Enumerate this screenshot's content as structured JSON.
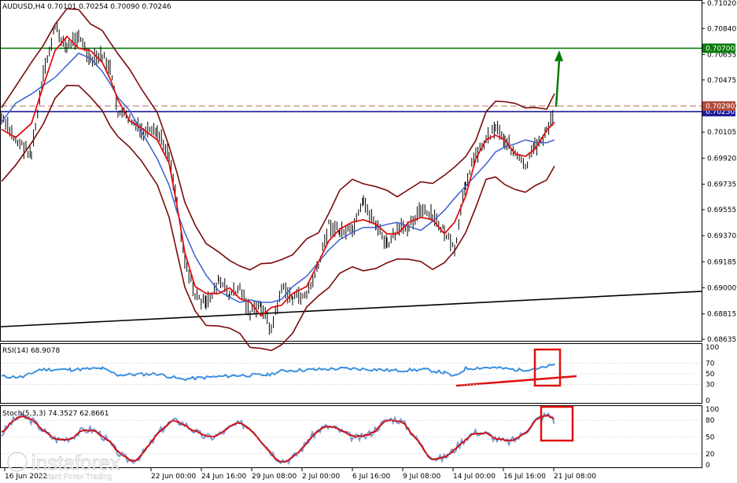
{
  "chart_data": {
    "type": "line",
    "title": "AUDUSD,H4",
    "ohlc": {
      "open": "0.70101",
      "high": "0.70254",
      "low": "0.70090",
      "close": "0.70246"
    },
    "ohlc_text": "AUDUSD,H4  0.70101 0.70254 0.70090 0.70246",
    "price_axis": {
      "ticks": [
        "0.71020",
        "0.70840",
        "0.70655",
        "0.70475",
        "0.70290",
        "0.70105",
        "0.69920",
        "0.69735",
        "0.69555",
        "0.69370",
        "0.69185",
        "0.69000",
        "0.68815",
        "0.68635"
      ],
      "ylim": [
        0.68635,
        0.7102
      ]
    },
    "time_axis": {
      "ticks": [
        "16 Jun 2022",
        "22 Jun 00:00",
        "24 Jun 16:00",
        "29 Jun 08:00",
        "2 Jul 00:00",
        "6 Jul 16:00",
        "9 Jul 08:00",
        "14 Jul 00:00",
        "16 Jul 16:00",
        "21 Jul 08:00"
      ]
    },
    "levels": [
      {
        "name": "resistance-green",
        "value": 0.707,
        "label": "0.70700",
        "color": "#0a7a0a"
      },
      {
        "name": "level-blue",
        "value": 0.7025,
        "label": "0.70250",
        "color": "#1c1c9a"
      },
      {
        "name": "level-dashed",
        "value": 0.7029,
        "label": "0.70290",
        "color": "#b07060"
      }
    ],
    "indicators": {
      "rsi": {
        "label": "RSI(14) 68.9078",
        "axis_ticks": [
          "100",
          "70",
          "50",
          "30",
          "0"
        ]
      },
      "stoch": {
        "label": "Stoch(5,3,3) 74.3527 62.8661",
        "axis_ticks": [
          "100",
          "80",
          "50",
          "20",
          "0"
        ]
      }
    },
    "colors": {
      "bollinger": "#7a0a0a",
      "ma_red": "#e01010",
      "ma_blue": "#3a5fd0",
      "rsi": "#3a8fe0",
      "stoch_main": "#7a9ad8",
      "stoch_signal": "#d01010",
      "annotation": "#e01010",
      "arrow": "#0a7a0a"
    },
    "grid": false
  },
  "watermark": {
    "brand": "instaforex",
    "tagline": "Instant Forex Trading"
  }
}
